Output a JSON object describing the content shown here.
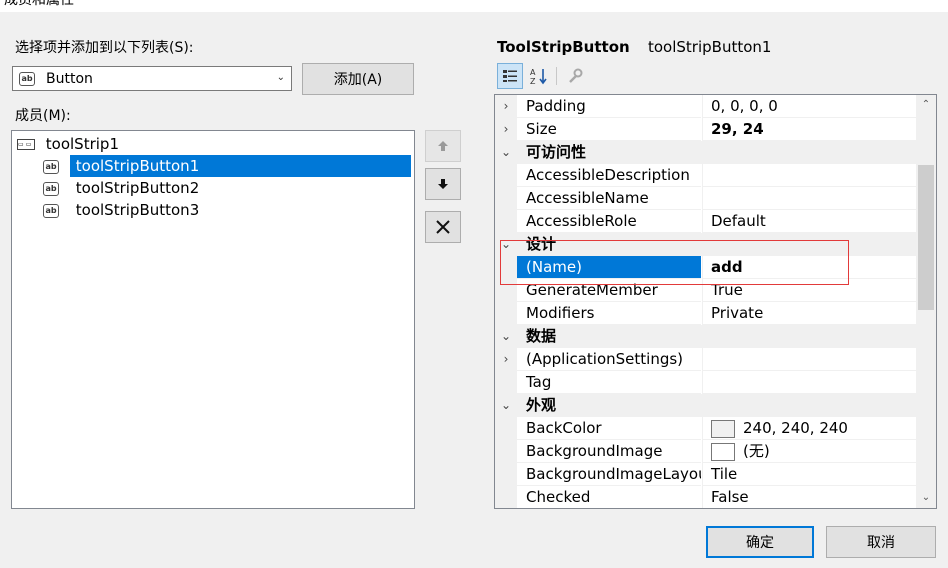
{
  "title": "成员和属性",
  "left": {
    "select_label": "选择项并添加到以下列表(S):",
    "combo_value": "Button",
    "add_button": "添加(A)",
    "members_label": "成员(M):",
    "tree": [
      {
        "label": "toolStrip1",
        "icon": "toolstrip-icon",
        "selected": false
      },
      {
        "label": "toolStripButton1",
        "icon": "button-icon",
        "selected": true
      },
      {
        "label": "toolStripButton2",
        "icon": "button-icon",
        "selected": false
      },
      {
        "label": "toolStripButton3",
        "icon": "button-icon",
        "selected": false
      }
    ],
    "side_buttons": [
      "arrow-up-icon",
      "arrow-down-icon",
      "delete-x-icon"
    ]
  },
  "right": {
    "object_type": "ToolStripButton",
    "object_name": "toolStripButton1",
    "toolbar": [
      "categorized-icon",
      "alphabetical-icon",
      "property-pages-icon"
    ],
    "rows": [
      {
        "kind": "prop",
        "expander": "›",
        "name": "Padding",
        "value": "0, 0, 0, 0"
      },
      {
        "kind": "prop",
        "expander": "›",
        "name": "Size",
        "value": "29, 24",
        "bold": true
      },
      {
        "kind": "cat",
        "expander": "⌄",
        "name": "可访问性"
      },
      {
        "kind": "prop",
        "name": "AccessibleDescription",
        "value": ""
      },
      {
        "kind": "prop",
        "name": "AccessibleName",
        "value": ""
      },
      {
        "kind": "prop",
        "name": "AccessibleRole",
        "value": "Default"
      },
      {
        "kind": "cat",
        "expander": "⌄",
        "name": "设计"
      },
      {
        "kind": "prop",
        "name": "(Name)",
        "value": "add",
        "bold": true,
        "selected": true
      },
      {
        "kind": "prop",
        "name": "GenerateMember",
        "value": "True"
      },
      {
        "kind": "prop",
        "name": "Modifiers",
        "value": "Private"
      },
      {
        "kind": "cat",
        "expander": "⌄",
        "name": "数据"
      },
      {
        "kind": "prop",
        "expander": "›",
        "name": "(ApplicationSettings)",
        "value": ""
      },
      {
        "kind": "prop",
        "name": "Tag",
        "value": ""
      },
      {
        "kind": "cat",
        "expander": "⌄",
        "name": "外观"
      },
      {
        "kind": "prop",
        "name": "BackColor",
        "value": "240, 240, 240",
        "swatch": "#f0f0f0"
      },
      {
        "kind": "prop",
        "name": "BackgroundImage",
        "value": "(无)",
        "swatch": "#ffffff"
      },
      {
        "kind": "prop",
        "name": "BackgroundImageLayout",
        "value": "Tile"
      },
      {
        "kind": "prop",
        "name": "Checked",
        "value": "False"
      }
    ]
  },
  "footer": {
    "ok": "确定",
    "cancel": "取消"
  },
  "colors": {
    "selection": "#0078d7",
    "highlight_box": "#e23a3a",
    "background": "#f0f0f0"
  }
}
